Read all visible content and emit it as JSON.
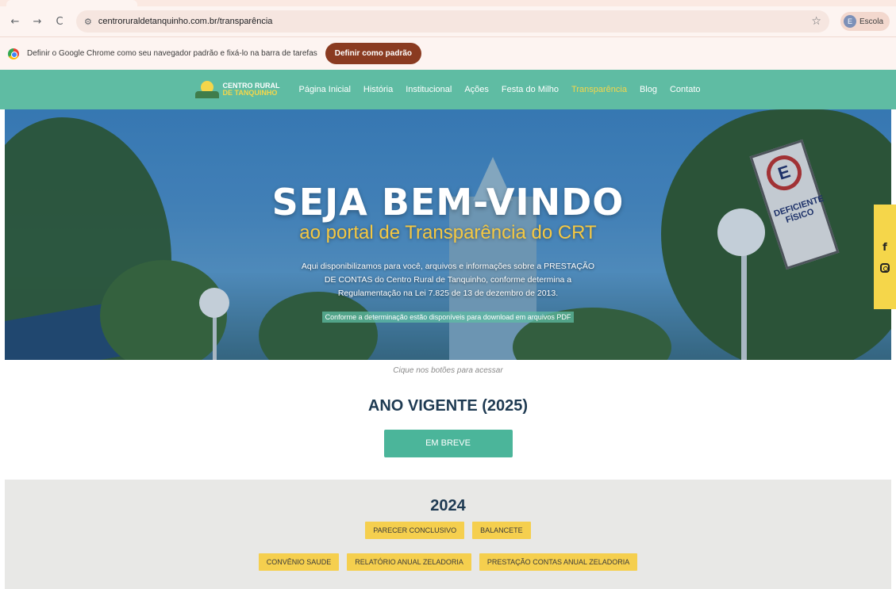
{
  "browser": {
    "url": "centroruraldetanquinho.com.br/transparência",
    "profile_initial": "E",
    "profile_name": "Escola",
    "nav_back": "←",
    "nav_forward": "→",
    "nav_reload": "C",
    "infobar_message": "Definir o Google Chrome como seu navegador padrão e fixá-lo na barra de tarefas",
    "infobar_button": "Definir como padrão"
  },
  "site": {
    "logo_line1": "CENTRO RURAL",
    "logo_line2": "DE TANQUINHO",
    "nav": [
      {
        "label": "Página Inicial"
      },
      {
        "label": "História"
      },
      {
        "label": "Institucional"
      },
      {
        "label": "Ações"
      },
      {
        "label": "Festa do Milho"
      },
      {
        "label": "Transparência",
        "active": true
      },
      {
        "label": "Blog"
      },
      {
        "label": "Contato"
      }
    ]
  },
  "hero": {
    "title": "SEJA BEM-VINDO",
    "subtitle": "ao portal de Transparência do CRT",
    "description": "Aqui disponibilizamos para você, arquivos e informações sobre a PRESTAÇÃO DE CONTAS do Centro Rural de Tanquinho, conforme determina a Regulamentação na Lei 7.825 de 13 de dezembro de 2013.",
    "note": "Conforme a determinação estão disponíveis para download em arquivos PDF",
    "sign_letter": "E",
    "sign_text": "DEFICIENTE FÍSICO"
  },
  "social": {
    "facebook": "f",
    "icons": [
      "facebook-icon",
      "instagram-icon"
    ]
  },
  "content": {
    "hint": "Cique nos botões para acessar",
    "current_title": "ANO VIGENTE (2025)",
    "current_button": "EM BREVE",
    "year_title": "2024",
    "row1": [
      "PARECER CONCLUSIVO",
      "BALANCETE"
    ],
    "row2": [
      "CONVÊNIO SAUDE",
      "RELATÓRIO ANUAL ZELADORIA",
      "PRESTAÇÃO CONTAS ANUAL ZELADORIA"
    ]
  },
  "colors": {
    "nav_bg": "#5fbca3",
    "accent_yellow": "#f5d64a",
    "button_green": "#4bb59a",
    "title_navy": "#1e3a52",
    "infobar_button": "#8a3b21"
  }
}
